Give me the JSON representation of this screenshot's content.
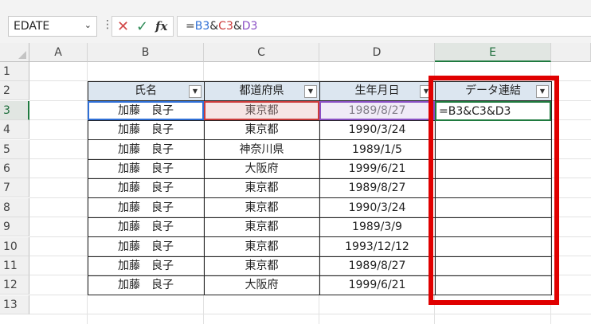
{
  "name_box": {
    "value": "EDATE"
  },
  "formula_bar": {
    "cancel_symbol": "✕",
    "enter_symbol": "✓",
    "fx_label": "fx",
    "formula_parts": [
      {
        "text": "=",
        "cls": "amp"
      },
      {
        "text": "B3",
        "cls": "ref-b"
      },
      {
        "text": "&",
        "cls": "amp"
      },
      {
        "text": "C3",
        "cls": "ref-c"
      },
      {
        "text": "&",
        "cls": "amp"
      },
      {
        "text": "D3",
        "cls": "ref-d"
      }
    ]
  },
  "columns": [
    "A",
    "B",
    "C",
    "D",
    "E"
  ],
  "rows": [
    "1",
    "2",
    "3",
    "4",
    "5",
    "6",
    "7",
    "8",
    "9",
    "10",
    "11",
    "12",
    "13"
  ],
  "table": {
    "headers": [
      "氏名",
      "都道府県",
      "生年月日",
      "データ連結"
    ],
    "rows": [
      [
        "加藤　良子",
        "東京都",
        "1989/8/27",
        "=B3&C3&D3"
      ],
      [
        "加藤　良子",
        "東京都",
        "1990/3/24",
        ""
      ],
      [
        "加藤　良子",
        "神奈川県",
        "1989/1/5",
        ""
      ],
      [
        "加藤　良子",
        "大阪府",
        "1999/6/21",
        ""
      ],
      [
        "加藤　良子",
        "東京都",
        "1989/8/27",
        ""
      ],
      [
        "加藤　良子",
        "東京都",
        "1990/3/24",
        ""
      ],
      [
        "加藤　良子",
        "東京都",
        "1989/3/9",
        ""
      ],
      [
        "加藤　良子",
        "東京都",
        "1993/12/12",
        ""
      ],
      [
        "加藤　良子",
        "東京都",
        "1989/8/27",
        ""
      ],
      [
        "加藤　良子",
        "大阪府",
        "1999/6/21",
        ""
      ]
    ]
  },
  "icons": {
    "filter": "chevron-down-icon",
    "cancel": "close-icon",
    "enter": "checkmark-icon",
    "function": "fx-icon"
  },
  "colors": {
    "highlight": "#e00000",
    "active_cell": "#1f7a3f",
    "ref_b": "#2f6fd6",
    "ref_c": "#cc3b3b",
    "ref_d": "#8a4fc4",
    "header_fill": "#dce6f0"
  }
}
